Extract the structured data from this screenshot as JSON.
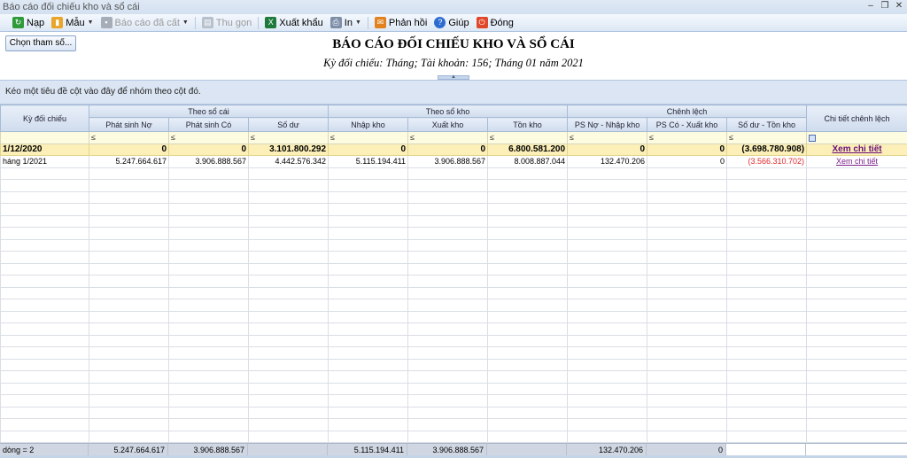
{
  "window": {
    "title": "Báo cáo đối chiếu kho và sổ cái"
  },
  "toolbar": {
    "nap": "Nạp",
    "mau": "Mẫu",
    "bao_cao_da_cat": "Báo cáo đã cất",
    "thu_gon": "Thu gọn",
    "xuat_khau": "Xuất khẩu",
    "in": "In",
    "phan_hoi": "Phản hồi",
    "giup": "Giúp",
    "dong": "Đóng"
  },
  "params_button": "Chọn tham số...",
  "report": {
    "title": "BÁO CÁO ĐỐI CHIẾU KHO VÀ SỔ CÁI",
    "subtitle": "Kỳ đối chiếu: Tháng; Tài khoản: 156; Tháng 01 năm 2021"
  },
  "group_panel_text": "Kéo một tiêu đề cột vào đây để nhóm theo cột đó.",
  "columns": {
    "ky_doi_chieu": "Kỳ đối chiếu",
    "theo_so_cai": "Theo sổ cái",
    "theo_so_kho": "Theo sổ kho",
    "chenh_lech": "Chênh lệch",
    "chi_tiet": "Chi tiết chênh lệch",
    "phat_sinh_no": "Phát sinh Nợ",
    "phat_sinh_co": "Phát sinh Có",
    "so_du": "Số dư",
    "nhap_kho": "Nhập kho",
    "xuat_kho": "Xuất kho",
    "ton_kho": "Tồn kho",
    "ps_no_nhap_kho": "PS Nợ - Nhập kho",
    "ps_co_xuat_kho": "PS Có - Xuất kho",
    "so_du_ton_kho": "Số dư - Tồn kho"
  },
  "filter_symbol": "≤",
  "rows": [
    {
      "ky": "1/12/2020",
      "no": "0",
      "co": "0",
      "sodu": "3.101.800.292",
      "nhap": "0",
      "xuat": "0",
      "ton": "6.800.581.200",
      "cl_no": "0",
      "cl_co": "0",
      "cl_du": "(3.698.780.908)",
      "link": "Xem chi tiết"
    },
    {
      "ky": "háng 1/2021",
      "no": "5.247.664.617",
      "co": "3.906.888.567",
      "sodu": "4.442.576.342",
      "nhap": "5.115.194.411",
      "xuat": "3.906.888.567",
      "ton": "8.008.887.044",
      "cl_no": "132.470.206",
      "cl_co": "0",
      "cl_du": "(3.566.310.702)",
      "link": "Xem chi tiết"
    }
  ],
  "footer": {
    "count": "dòng = 2",
    "no": "5.247.664.617",
    "co": "3.906.888.567",
    "nhap": "5.115.194.411",
    "xuat": "3.906.888.567",
    "cl_no": "132.470.206",
    "cl_co": "0"
  }
}
